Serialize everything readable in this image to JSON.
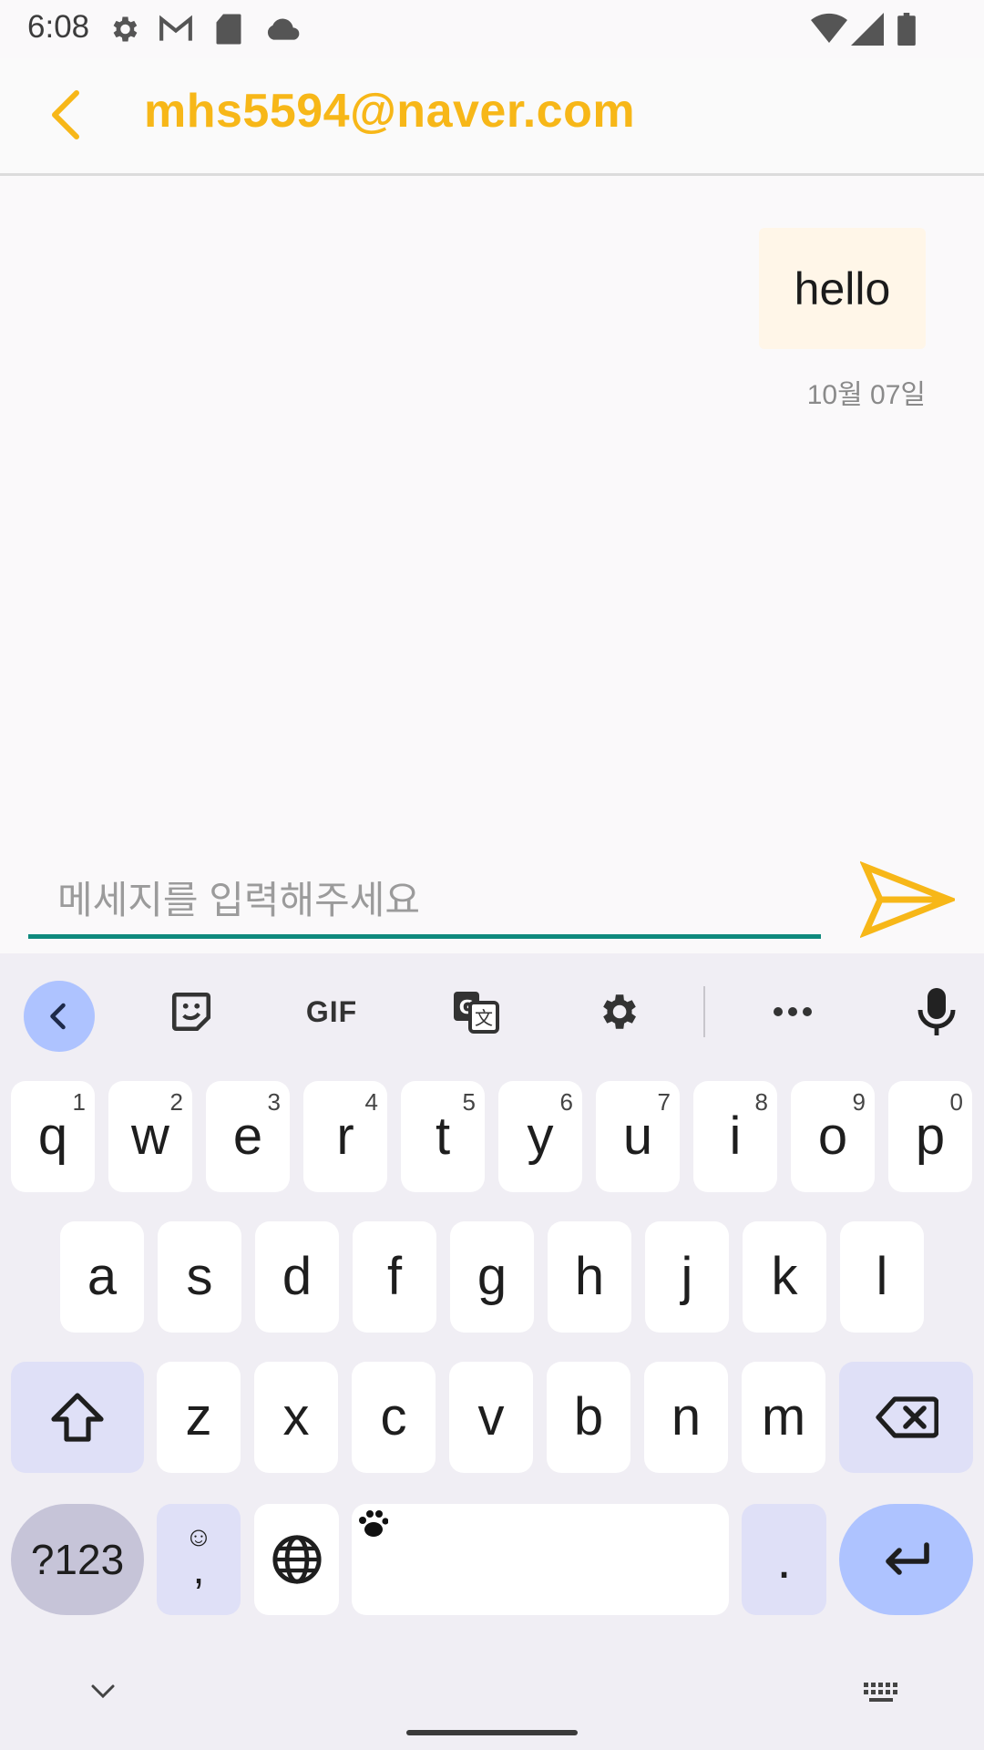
{
  "status_bar": {
    "time": "6:08",
    "icons": [
      "settings-icon",
      "gmail-icon",
      "sd-card-icon",
      "cloud-icon",
      "wifi-icon",
      "signal-icon",
      "battery-icon"
    ]
  },
  "header": {
    "title": "mhs5594@naver.com",
    "accent_color": "#f7b718"
  },
  "chat": {
    "messages": [
      {
        "text": "hello",
        "date": "10월 07일"
      }
    ]
  },
  "composer": {
    "placeholder": "메세지를 입력해주세요",
    "value": "",
    "send_icon": "send-icon"
  },
  "keyboard": {
    "toolbar": {
      "items": [
        "collapse-icon",
        "sticker-icon",
        "GIF",
        "translate-icon",
        "settings-icon",
        "more-icon",
        "microphone-icon"
      ],
      "gif_label": "GIF"
    },
    "row1": [
      {
        "key": "q",
        "hint": "1"
      },
      {
        "key": "w",
        "hint": "2"
      },
      {
        "key": "e",
        "hint": "3"
      },
      {
        "key": "r",
        "hint": "4"
      },
      {
        "key": "t",
        "hint": "5"
      },
      {
        "key": "y",
        "hint": "6"
      },
      {
        "key": "u",
        "hint": "7"
      },
      {
        "key": "i",
        "hint": "8"
      },
      {
        "key": "o",
        "hint": "9"
      },
      {
        "key": "p",
        "hint": "0"
      }
    ],
    "row2": [
      "a",
      "s",
      "d",
      "f",
      "g",
      "h",
      "j",
      "k",
      "l"
    ],
    "row3": [
      "z",
      "x",
      "c",
      "v",
      "b",
      "n",
      "m"
    ],
    "bottom": {
      "symbols_label": "?123",
      "emoji_top": "☺",
      "comma": ",",
      "period": "."
    },
    "colors": {
      "key_bg": "#ffffff",
      "function_key_bg": "#dfe0f7",
      "enter_bg": "#aec3ff",
      "keyboard_bg": "#f0eef4"
    }
  }
}
